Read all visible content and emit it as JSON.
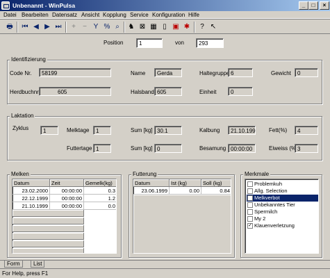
{
  "window": {
    "title": "Unbenannt - WinPulsa",
    "controls": [
      "_",
      "□",
      "×"
    ]
  },
  "menu": [
    "Datei",
    "Bearbeiten",
    "Datensatz",
    "Ansicht",
    "Kopplung",
    "Service",
    "Konfiguration",
    "Hilfe"
  ],
  "toolbar_icons": [
    "print-icon",
    "first-record-icon",
    "prev-record-icon",
    "next-record-icon",
    "last-record-icon",
    "add-icon",
    "remove-icon",
    "filter-icon",
    "percent-icon",
    "search-icon",
    "cow-icon",
    "grid-icon",
    "table-icon",
    "save-icon",
    "calculator-icon",
    "export-icon",
    "help-icon",
    "context-help-icon"
  ],
  "position": {
    "label": "Position",
    "value": "1",
    "von_label": "von",
    "total": "293"
  },
  "identifizierung": {
    "title": "Identifizierung",
    "code_label": "Code Nr.",
    "code": "58199",
    "name_label": "Name",
    "name": "Gerda",
    "haltegruppe_label": "Haltegruppe",
    "haltegruppe": "6",
    "gewicht_label": "Gewicht",
    "gewicht": "0",
    "herdbuch_label": "Herdbuchnr.",
    "herdbuch": "605",
    "halsband_label": "Halsband",
    "halsband": "605",
    "einheit_label": "Einheit",
    "einheit": "0"
  },
  "laktation": {
    "title": "Laktation",
    "zyklus_label": "Zyklus",
    "zyklus": "1",
    "melktage_label": "Melktage",
    "melktage": "1",
    "sum1_label": "Sum [kg]",
    "sum1": "30.1",
    "kalbung_label": "Kalbung",
    "kalbung": "21.10.199",
    "fett_label": "Fett(%)",
    "fett": "4",
    "futtertage_label": "Futtertage",
    "futtertage": "1",
    "sum2_label": "Sum [kg]",
    "sum2": "0",
    "besamung_label": "Besamung",
    "besamung": "00:00:00",
    "eiweiss_label": "Eiweiss (%)",
    "eiweiss": "3"
  },
  "melken": {
    "title": "Melken",
    "headers": [
      "Datum",
      "Zeit",
      "Gemelk(kg)"
    ],
    "rows": [
      [
        "23.02.2000",
        "00:00:00",
        "0.3"
      ],
      [
        "22.12.1999",
        "00:00:00",
        "1.2"
      ],
      [
        "21.10.1999",
        "00:00:00",
        "0.0"
      ]
    ]
  },
  "futterung": {
    "title": "Futterung",
    "headers": [
      "Datum",
      "Ist (kg)",
      "Soll (kg)"
    ],
    "rows": [
      [
        "23.06.1999",
        "0.00",
        "0.84"
      ]
    ]
  },
  "merkmale": {
    "title": "Merkmale",
    "items": [
      {
        "label": "Problemkuh",
        "checked": false,
        "selected": false
      },
      {
        "label": "Allg. Selection",
        "checked": false,
        "selected": false
      },
      {
        "label": "Melkverbot",
        "checked": false,
        "selected": true
      },
      {
        "label": "Unbekanntes Tier",
        "checked": false,
        "selected": false
      },
      {
        "label": "Spermilch",
        "checked": false,
        "selected": false
      },
      {
        "label": "My 2",
        "checked": false,
        "selected": false
      },
      {
        "label": "Klauenverletzung",
        "checked": true,
        "selected": false
      }
    ]
  },
  "tabs": [
    "Form",
    "List"
  ],
  "status": "For Help, press F1"
}
